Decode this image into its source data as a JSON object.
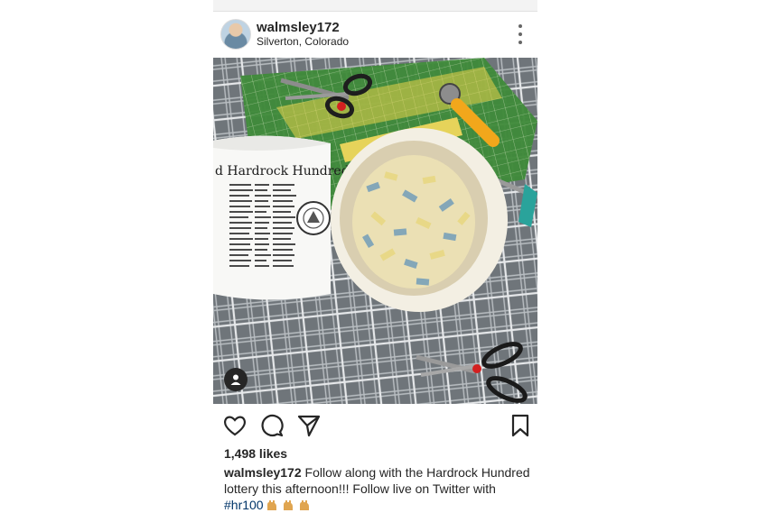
{
  "post": {
    "username": "walmsley172",
    "location": "Silverton, Colorado",
    "likes": "1,498 likes",
    "caption": {
      "username": "walmsley172",
      "text": " Follow along with the Hardrock Hundred lottery this afternoon!!! Follow live on Twitter with ",
      "hashtag": "#hr100"
    },
    "photo": {
      "mug_text": "d Hardrock Hundred"
    }
  },
  "icons": {
    "more": "more-options-icon",
    "like": "heart-icon",
    "comment": "comment-icon",
    "share": "share-icon",
    "save": "bookmark-icon",
    "tag": "user-tag-icon",
    "emoji": "raised-hands-emoji"
  },
  "colors": {
    "text": "#262626",
    "hashtag": "#003569",
    "cutting_mat": "#3f8a3a",
    "cutter_handle": "#f2a71b"
  }
}
